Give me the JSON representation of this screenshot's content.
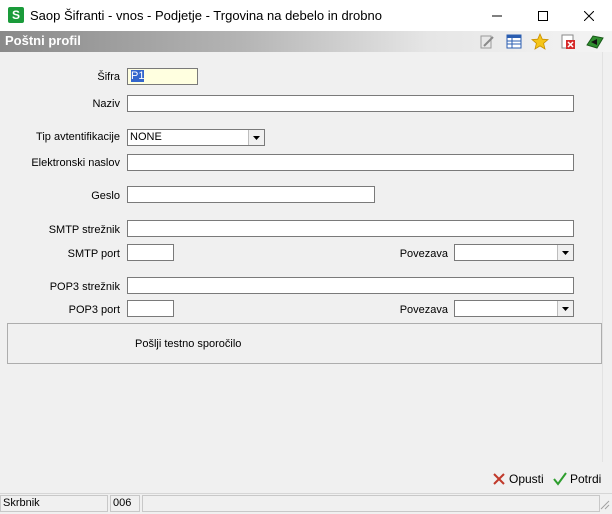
{
  "window": {
    "title": "Saop Šifranti - vnos - Podjetje - Trgovina na debelo in drobno",
    "app_icon_letter": "S"
  },
  "header": {
    "title": "Poštni profil"
  },
  "form": {
    "sifra_label": "Šifra",
    "sifra_value": "P1",
    "naziv_label": "Naziv",
    "naziv_value": "",
    "tip_label": "Tip avtentifikacije",
    "tip_value": "NONE",
    "email_label": "Elektronski naslov",
    "email_value": "",
    "geslo_label": "Geslo",
    "geslo_value": "",
    "smtp_server_label": "SMTP strežnik",
    "smtp_server_value": "",
    "smtp_port_label": "SMTP port",
    "smtp_port_value": "",
    "smtp_povezava_label": "Povezava",
    "smtp_povezava_value": "",
    "pop3_server_label": "POP3 strežnik",
    "pop3_server_value": "",
    "pop3_port_label": "POP3 port",
    "pop3_port_value": "",
    "pop3_povezava_label": "Povezava",
    "pop3_povezava_value": "",
    "test_button_label": "Pošlji testno sporočilo"
  },
  "buttons": {
    "cancel_label": "Opusti",
    "confirm_label": "Potrdi"
  },
  "statusbar": {
    "user": "Skrbnik",
    "code": "006"
  },
  "colors": {
    "app_icon": "#1a9b3a",
    "selection": "#3366cc",
    "cancel_x": "#c0392b",
    "confirm_check": "#2e9e2e"
  }
}
